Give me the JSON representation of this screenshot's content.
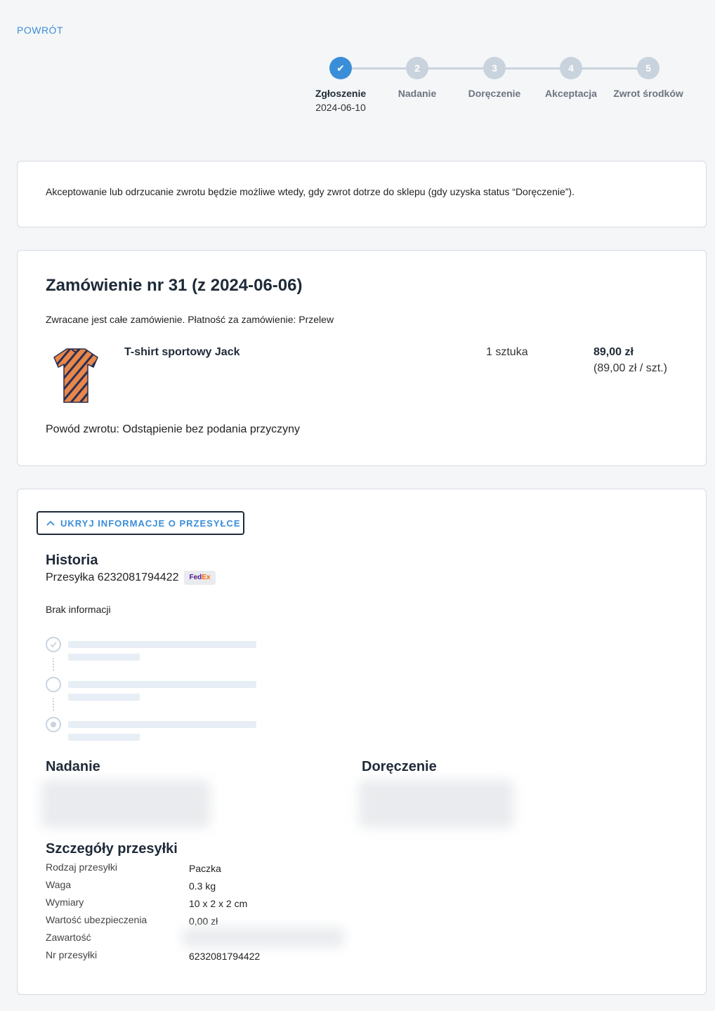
{
  "nav": {
    "back_label": "POWRÓT"
  },
  "stepper": {
    "steps": [
      {
        "number": "✔",
        "label": "Zgłoszenie",
        "date": "2024-06-10",
        "active": true
      },
      {
        "number": "2",
        "label": "Nadanie"
      },
      {
        "number": "3",
        "label": "Doręczenie"
      },
      {
        "number": "4",
        "label": "Akceptacja"
      },
      {
        "number": "5",
        "label": "Zwrot środków"
      }
    ]
  },
  "info": {
    "text": "Akceptowanie lub odrzucanie zwrotu będzie możliwe wtedy, gdy zwrot dotrze do sklepu (gdy uzyska status “Doręczenie”)."
  },
  "order": {
    "title": "Zamówienie nr 31 (z 2024-06-06)",
    "subtitle": "Zwracane jest całe zamówienie. Płatność za zamówienie: Przelew",
    "product": {
      "name": "T-shirt sportowy Jack",
      "quantity": "1 sztuka",
      "price": "89,00 zł",
      "unit_price": "(89,00 zł / szt.)"
    },
    "return_reason": "Powód zwrotu: Odstąpienie bez podania przyczyny"
  },
  "shipment": {
    "toggle_label": "UKRYJ INFORMACJE O PRZESYŁCE",
    "history_title": "Historia",
    "tracking_label": "Przesyłka 6232081794422",
    "carrier": {
      "part1": "Fed",
      "part2": "Ex"
    },
    "no_info": "Brak informacji",
    "sender_title": "Nadanie",
    "delivery_title": "Doręczenie",
    "details_title": "Szczegóły przesyłki",
    "details": [
      {
        "label": "Rodzaj przesyłki",
        "value": "Paczka"
      },
      {
        "label": "Waga",
        "value": "0.3 kg"
      },
      {
        "label": "Wymiary",
        "value": "10 x 2 x 2 cm"
      },
      {
        "label": "Wartość ubezpieczenia",
        "value": "0,00 zł"
      },
      {
        "label": "Zawartość",
        "value": ""
      },
      {
        "label": "Nr przesyłki",
        "value": "6232081794422"
      }
    ]
  },
  "colors": {
    "accent": "#3a8ed8",
    "inactive_step": "#c9d3dd",
    "heading": "#1e2a38"
  }
}
